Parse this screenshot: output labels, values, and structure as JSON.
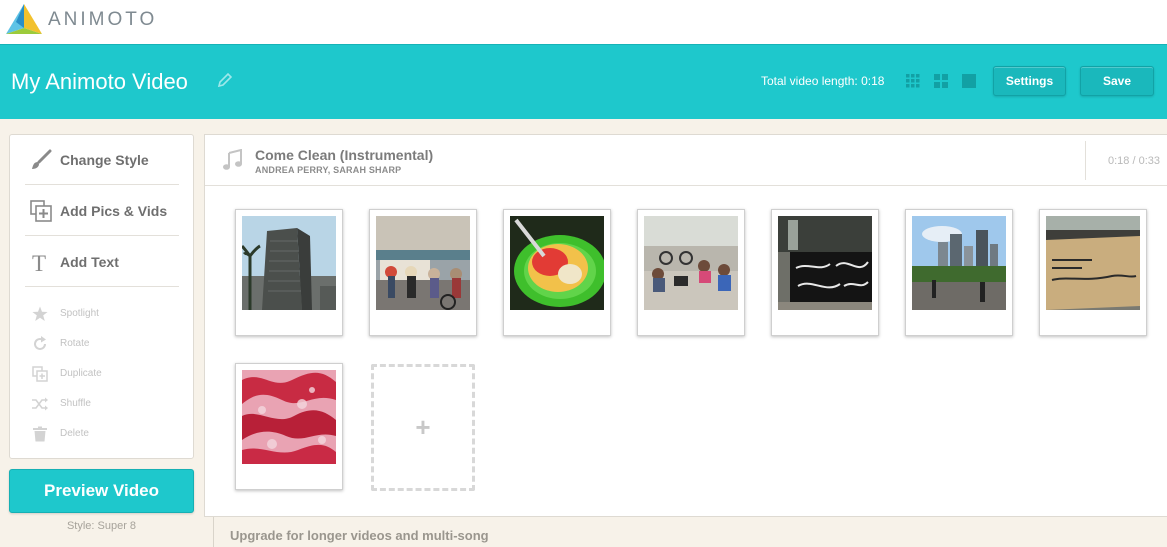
{
  "brand": {
    "name": "ANIMOTO"
  },
  "header": {
    "title": "My Animoto Video",
    "total_label": "Total video length:",
    "total_value": "0:18",
    "view_icons": [
      "small-grid-icon",
      "medium-grid-icon",
      "large-square-icon"
    ],
    "settings_label": "Settings",
    "save_label": "Save"
  },
  "tools": [
    {
      "label": "Change Style",
      "icon": "paintbrush-icon"
    },
    {
      "label": "Add Pics & Vids",
      "icon": "add-media-icon"
    },
    {
      "label": "Add Text",
      "icon": "text-icon"
    }
  ],
  "actions": [
    {
      "label": "Spotlight",
      "icon": "star-icon"
    },
    {
      "label": "Rotate",
      "icon": "rotate-icon"
    },
    {
      "label": "Duplicate",
      "icon": "duplicate-icon"
    },
    {
      "label": "Shuffle",
      "icon": "shuffle-icon"
    },
    {
      "label": "Delete",
      "icon": "trash-icon"
    }
  ],
  "preview": {
    "label": "Preview Video",
    "style_label": "Style: Super 8"
  },
  "song": {
    "title": "Come Clean (Instrumental)",
    "artist": "ANDREA PERRY, SARAH SHARP",
    "time": "0:18 / 0:33"
  },
  "upgrade": {
    "label": "Upgrade for longer videos and multi-song"
  },
  "colors": {
    "accent": "#1ec8cc",
    "background": "#f7f2e9"
  }
}
